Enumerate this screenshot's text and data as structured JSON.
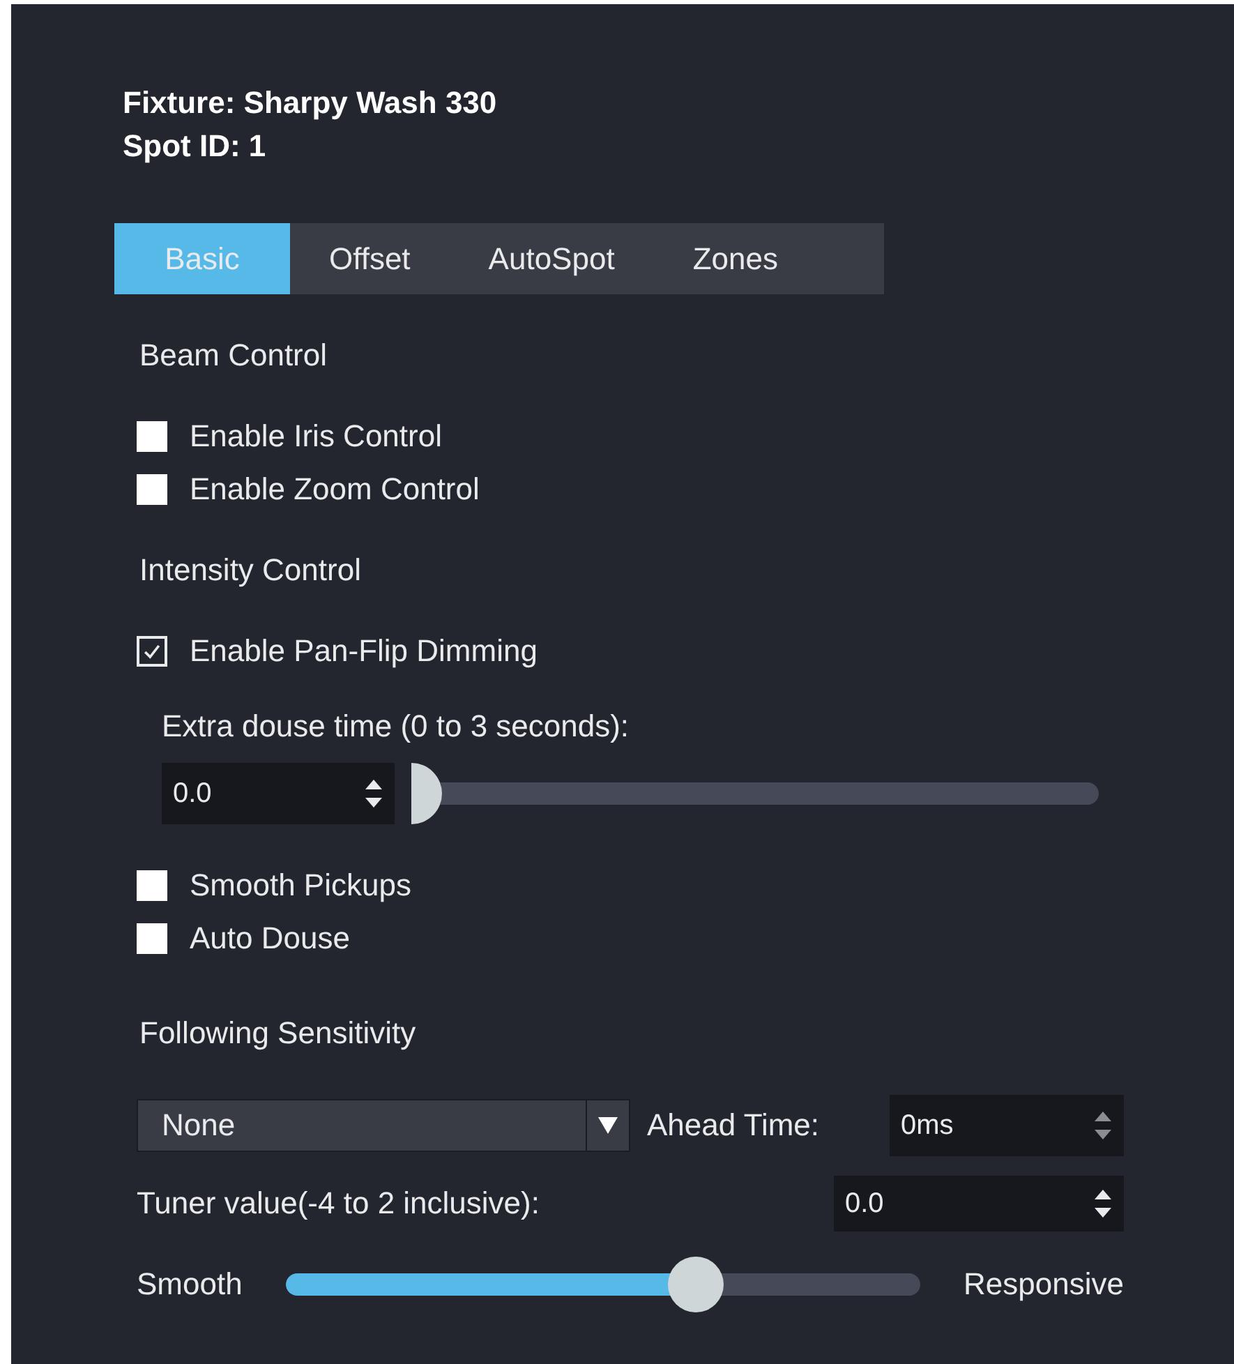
{
  "header": {
    "fixture": "Fixture: Sharpy Wash 330",
    "spot_id": "Spot ID: 1"
  },
  "tabs": [
    {
      "label": "Basic",
      "selected": true
    },
    {
      "label": "Offset",
      "selected": false
    },
    {
      "label": "AutoSpot",
      "selected": false
    },
    {
      "label": "Zones",
      "selected": false
    }
  ],
  "beam_control": {
    "title": "Beam Control",
    "options": [
      {
        "label": "Enable Iris Control",
        "checked": false
      },
      {
        "label": "Enable Zoom Control",
        "checked": false
      }
    ]
  },
  "intensity_control": {
    "title": "Intensity Control",
    "pan_flip": {
      "label": "Enable Pan-Flip Dimming",
      "checked": true
    },
    "douse_label": "Extra douse time (0 to 3 seconds):",
    "douse_value": "0.0",
    "douse_slider": {
      "level": 0
    },
    "options": [
      {
        "label": "Smooth Pickups",
        "checked": false
      },
      {
        "label": "Auto Douse",
        "checked": false
      }
    ]
  },
  "following_sensitivity": {
    "title": "Following Sensitivity",
    "dropdown": "None",
    "ahead_label": "Ahead Time:",
    "ahead_value": "0ms",
    "tuner_label": "Tuner value(-4 to 2 inclusive):",
    "tuner_value": "0.0",
    "slider_min_label": "Smooth",
    "slider_max_label": "Responsive",
    "level": 0.66
  }
}
